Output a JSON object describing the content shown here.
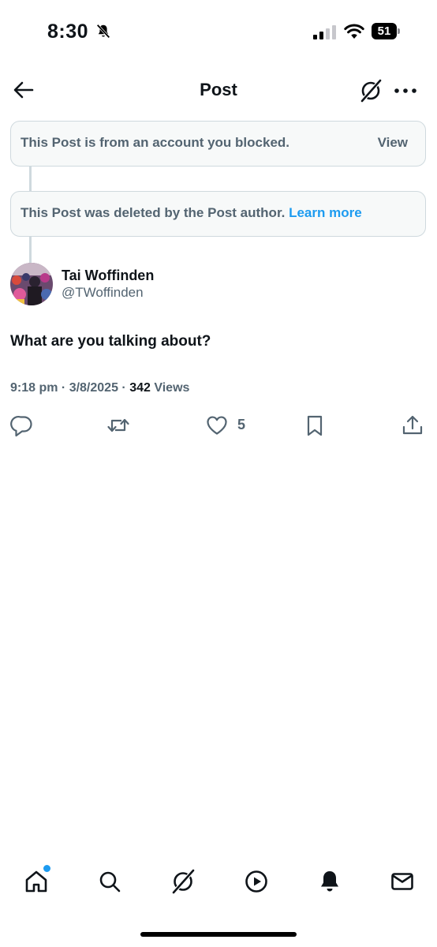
{
  "status_bar": {
    "time": "8:30",
    "battery": "51",
    "icons": [
      "bell-off-icon",
      "signal-icon",
      "wifi-icon",
      "battery-icon"
    ]
  },
  "header": {
    "title": "Post",
    "icons": [
      "back-arrow-icon",
      "grok-icon",
      "more-icon"
    ]
  },
  "notices": {
    "blocked": {
      "text": "This Post is from an account you blocked.",
      "action": "View"
    },
    "deleted": {
      "text": "This Post was deleted by the Post author.",
      "link": "Learn more"
    }
  },
  "post": {
    "author_name": "Tai Woffinden",
    "author_handle": "@TWoffinden",
    "text": "What are you talking about?",
    "time": "9:18 pm",
    "date": "3/8/2025",
    "views_count": "342",
    "views_label": "Views",
    "like_count": "5"
  },
  "actions": [
    "reply-icon",
    "repost-icon",
    "like-icon",
    "bookmark-icon",
    "share-icon"
  ],
  "bottom_nav": [
    "home-icon",
    "search-icon",
    "grok-icon",
    "video-icon",
    "notifications-icon",
    "messages-icon"
  ],
  "colors": {
    "accent": "#1d9bf0",
    "text_primary": "#0f1419",
    "text_secondary": "#536471",
    "notice_bg": "#f7f9f9",
    "border": "#cfd9de"
  }
}
